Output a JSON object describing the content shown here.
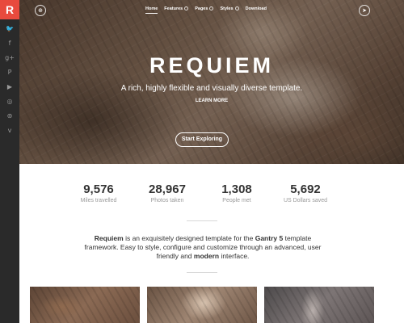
{
  "sidebar": {
    "logo_letter": "R",
    "social_icons": [
      {
        "name": "twitter-icon",
        "glyph": "🐦"
      },
      {
        "name": "facebook-icon",
        "glyph": "f"
      },
      {
        "name": "google-plus-icon",
        "glyph": "g+"
      },
      {
        "name": "pinterest-icon",
        "glyph": "P"
      },
      {
        "name": "youtube-icon",
        "glyph": "▶"
      },
      {
        "name": "instagram-icon",
        "glyph": "◎"
      },
      {
        "name": "flickr-icon",
        "glyph": "⊚"
      },
      {
        "name": "vimeo-icon",
        "glyph": "v"
      }
    ]
  },
  "hero": {
    "menu_icon": "⊕",
    "nav": [
      {
        "label": "Home",
        "active": true,
        "has_dropdown": false
      },
      {
        "label": "Features",
        "active": false,
        "has_dropdown": true
      },
      {
        "label": "Pages",
        "active": false,
        "has_dropdown": true
      },
      {
        "label": "Styles",
        "active": false,
        "has_dropdown": true
      },
      {
        "label": "Download",
        "active": false,
        "has_dropdown": false
      }
    ],
    "share_icon": "➤",
    "title": "REQUIEM",
    "subtitle": "A rich, highly flexible and visually diverse template.",
    "learn_more": "LEARN MORE",
    "cta": "Start Exploring"
  },
  "stats": [
    {
      "value": "9,576",
      "label": "Miles travelled"
    },
    {
      "value": "28,967",
      "label": "Photos taken"
    },
    {
      "value": "1,308",
      "label": "People met"
    },
    {
      "value": "5,692",
      "label": "US Dollars saved"
    }
  ],
  "intro": {
    "brand": "Requiem",
    "part1": " is an exquisitely designed template for the ",
    "framework": "Gantry 5",
    "part2": " template framework. Easy to style, configure and customize through an advanced, user friendly and ",
    "modern": "modern",
    "part3": " interface."
  },
  "colors": {
    "accent": "#e84a3d",
    "sidebar_bg": "#2a2a2a"
  }
}
